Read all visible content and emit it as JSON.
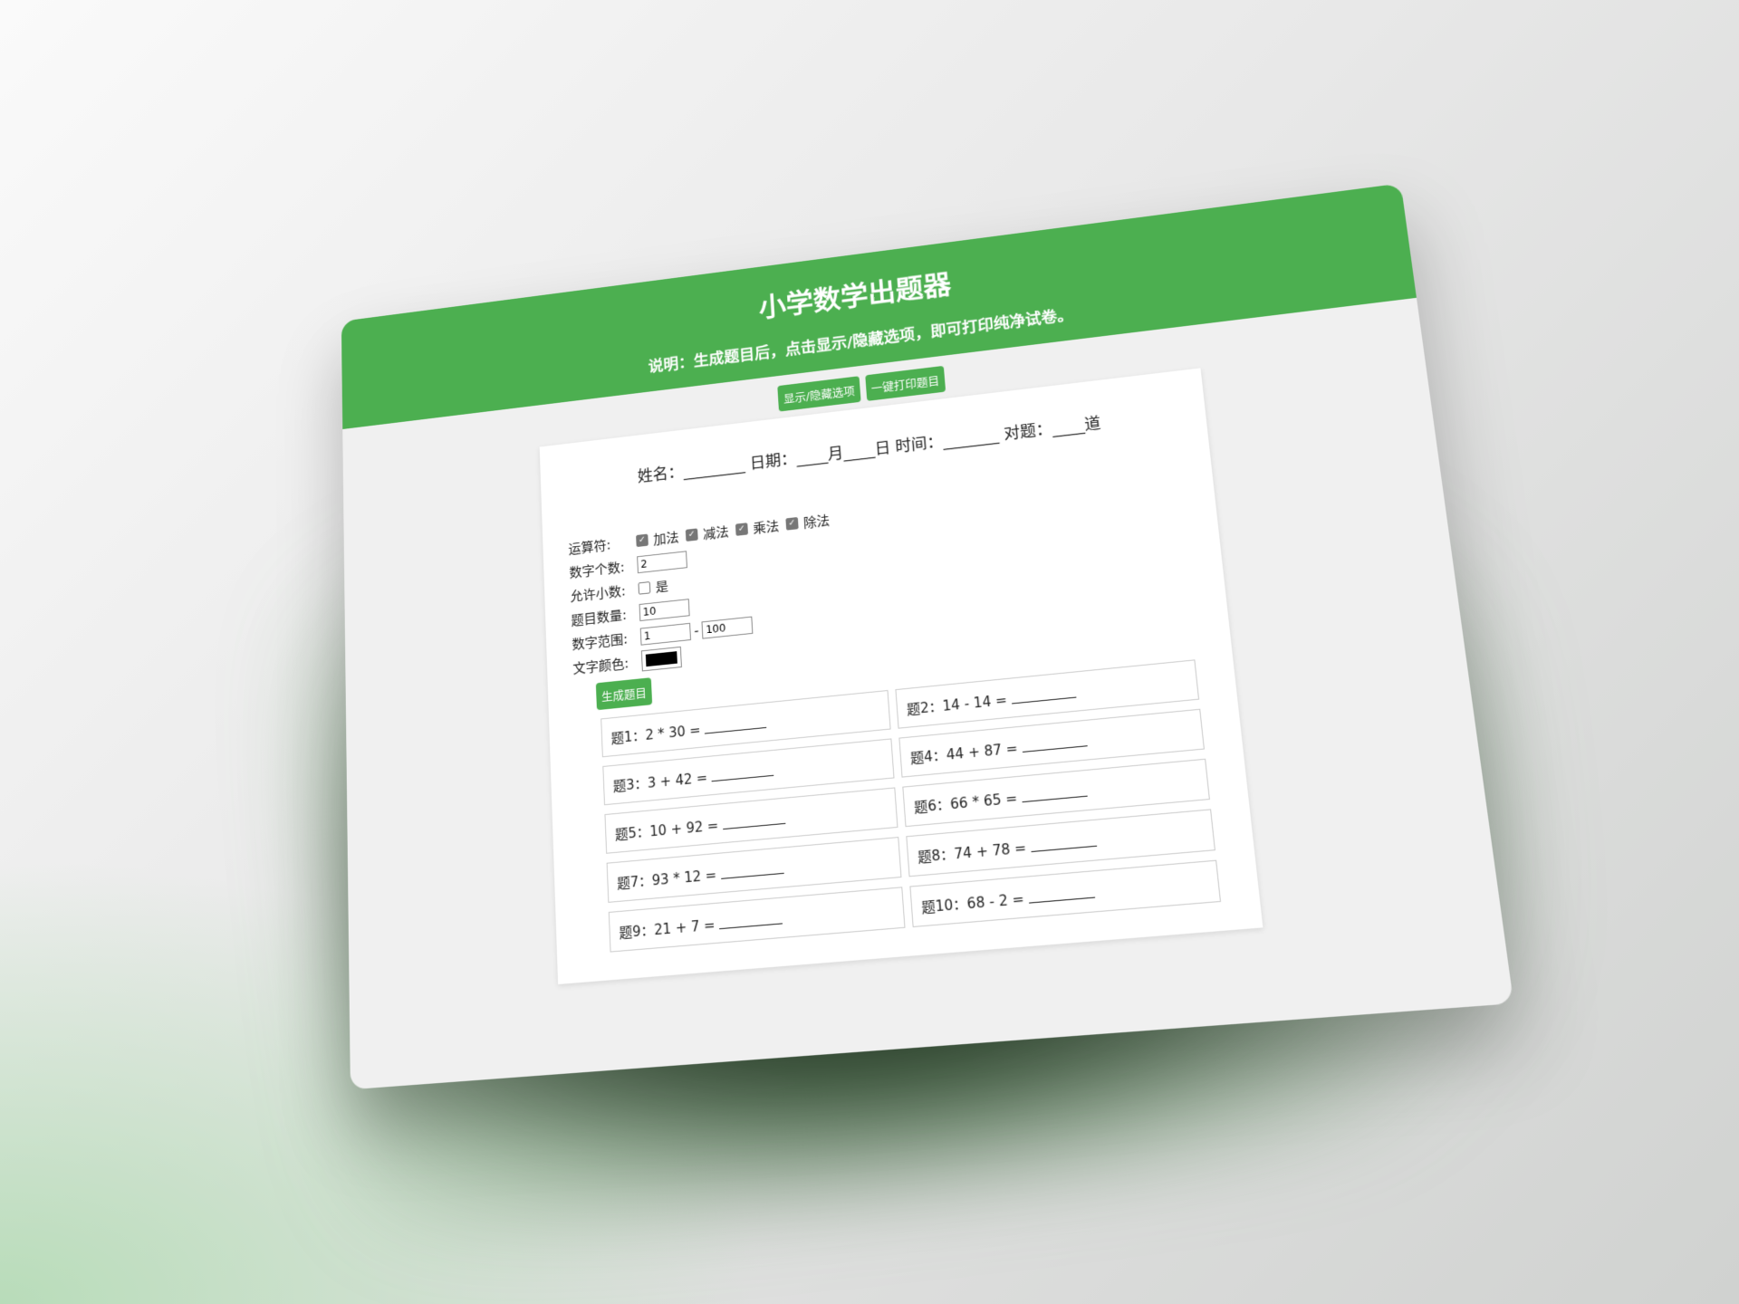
{
  "header": {
    "title": "小学数学出题器",
    "description": "说明：生成题目后，点击显示/隐藏选项，即可打印纯净试卷。"
  },
  "toolbar": {
    "toggle_label": "显示/隐藏选项",
    "print_label": "一键打印题目"
  },
  "info_line": "姓名：________ 日期：____月____日 时间：_______ 对题：____道",
  "options": {
    "operators_label": "运算符:",
    "operators": [
      {
        "label": "加法",
        "checked": true
      },
      {
        "label": "减法",
        "checked": true
      },
      {
        "label": "乘法",
        "checked": true
      },
      {
        "label": "除法",
        "checked": true
      }
    ],
    "count_label": "数字个数:",
    "count_value": "2",
    "decimal_label": "允许小数:",
    "decimal_option": "是",
    "quantity_label": "题目数量:",
    "quantity_value": "10",
    "range_label": "数字范围:",
    "range_min": "1",
    "range_sep": "-",
    "range_max": "100",
    "color_label": "文字颜色:",
    "color_value": "#000000",
    "generate_label": "生成题目"
  },
  "questions": [
    {
      "label": "题1：",
      "expr": "2 * 30 ="
    },
    {
      "label": "题2：",
      "expr": "14 - 14 ="
    },
    {
      "label": "题3：",
      "expr": "3 + 42 ="
    },
    {
      "label": "题4：",
      "expr": "44 + 87 ="
    },
    {
      "label": "题5：",
      "expr": "10 + 92 ="
    },
    {
      "label": "题6：",
      "expr": "66 * 65 ="
    },
    {
      "label": "题7：",
      "expr": "93 * 12 ="
    },
    {
      "label": "题8：",
      "expr": "74 + 78 ="
    },
    {
      "label": "题9：",
      "expr": "21 + 7 ="
    },
    {
      "label": "题10：",
      "expr": "68 - 2 ="
    }
  ],
  "colors": {
    "accent": "#4caf50",
    "background": "#f0f0f0"
  }
}
